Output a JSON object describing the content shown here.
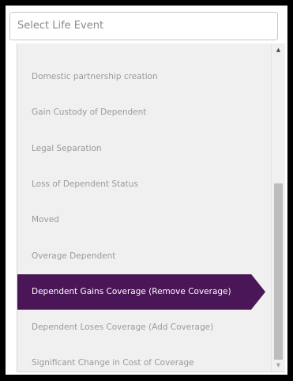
{
  "select": {
    "placeholder": "Select Life Event"
  },
  "options": [
    {
      "label": "Domestic partnership creation",
      "selected": false
    },
    {
      "label": "Gain Custody of Dependent",
      "selected": false
    },
    {
      "label": "Legal Separation",
      "selected": false
    },
    {
      "label": "Loss of Dependent Status",
      "selected": false
    },
    {
      "label": "Moved",
      "selected": false
    },
    {
      "label": "Overage Dependent",
      "selected": false
    },
    {
      "label": "Dependent Gains Coverage (Remove Coverage)",
      "selected": true
    },
    {
      "label": "Dependent Loses Coverage (Add Coverage)",
      "selected": false
    },
    {
      "label": "Significant Change in Cost of Coverage",
      "selected": false
    }
  ],
  "scrollbar": {
    "position_fraction": 0.42,
    "visible_fraction": 0.58
  },
  "icons": {
    "scroll_up": "triangle-up-icon",
    "scroll_down": "triangle-down-icon"
  },
  "colors": {
    "selected_background": "#4a1657",
    "selected_text": "#ffffff",
    "item_text": "#9a9a9a",
    "list_background": "#f0f0f0"
  }
}
